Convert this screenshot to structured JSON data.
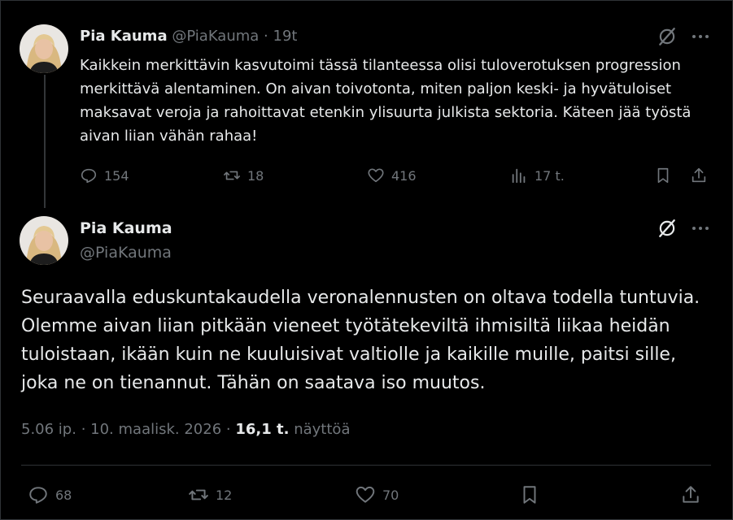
{
  "tweet1": {
    "author_name": "Pia Kauma",
    "author_handle": "@PiaKauma",
    "separator": "·",
    "time": "19t",
    "text": "Kaikkein merkittävin kasvutoimi tässä tilanteessa olisi tuloverotuksen progression merkittävä alentaminen. On aivan toivotonta, miten paljon keski- ja hyvätuloiset maksavat veroja ja rahoittavat etenkin ylisuurta julkista sektoria. Käteen jää työstä aivan liian vähän rahaa!",
    "replies": "154",
    "reposts": "18",
    "likes": "416",
    "views": "17 t."
  },
  "tweet2": {
    "author_name": "Pia Kauma",
    "author_handle": "@PiaKauma",
    "text": "Seuraavalla eduskuntakaudella veronalennusten on oltava todella tuntuvia. Olemme aivan liian pitkään vieneet työtätekeviltä ihmisiltä liikaa heidän tuloistaan, ikään kuin ne kuuluisivat valtiolle ja kaikille muille, paitsi sille, joka ne on tienannut. Tähän on saatava iso muutos.",
    "time": "5.06 ip.",
    "dot": "·",
    "date": "10. maalisk. 2026",
    "views_count": "16,1 t.",
    "views_label": "näyttöä",
    "replies": "68",
    "reposts": "12",
    "likes": "70"
  },
  "icons": {
    "reply": "reply-icon",
    "repost": "repost-icon",
    "like": "heart-icon",
    "views": "views-icon",
    "bookmark": "bookmark-icon",
    "share": "share-icon",
    "more": "more-icon",
    "grok": "grok-icon"
  },
  "colors": {
    "background": "#000000",
    "text": "#e7e9ea",
    "muted": "#71767b",
    "border": "#2f3336"
  }
}
